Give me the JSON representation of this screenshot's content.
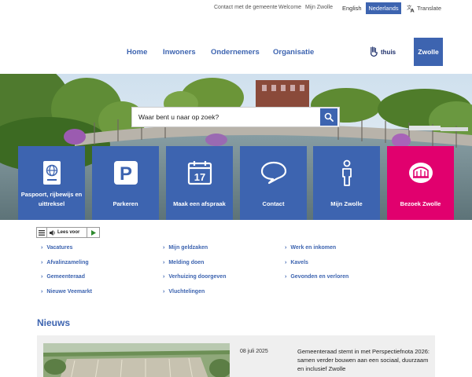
{
  "topbar": {
    "contact": "Contact met de gemeente",
    "welcome": "Welcome",
    "mijn_zwolle": "Mijn Zwolle",
    "lang_en": "English",
    "lang_nl": "Nederlands",
    "translate": "Translate"
  },
  "nav": {
    "items": [
      "Home",
      "Inwoners",
      "Ondernemers",
      "Organisatie"
    ],
    "thuis": "thuis",
    "logo": "Zwolle"
  },
  "search": {
    "placeholder": "Waar bent u naar op zoek?"
  },
  "tiles": [
    {
      "label": "Paspoort, rijbewijs en uittreksel",
      "icon": "passport-icon"
    },
    {
      "label": "Parkeren",
      "icon": "parking-icon"
    },
    {
      "label": "Maak een afspraak",
      "icon": "calendar-icon",
      "day": "17"
    },
    {
      "label": "Contact",
      "icon": "speech-bubble-icon"
    },
    {
      "label": "Mijn Zwolle",
      "icon": "person-icon"
    },
    {
      "label": "Bezoek Zwolle",
      "icon": "building-icon"
    }
  ],
  "readspeaker": {
    "label": "Lees voor"
  },
  "quicklinks": {
    "col1": [
      "Vacatures",
      "Afvalinzameling",
      "Gemeenteraad",
      "Nieuwe Veemarkt"
    ],
    "col2": [
      "Mijn geldzaken",
      "Melding doen",
      "Verhuizing doorgeven",
      "Vluchtelingen"
    ],
    "col3": [
      "Werk en inkomen",
      "Kavels",
      "Gevonden en verloren"
    ]
  },
  "news": {
    "title": "Nieuws",
    "items": [
      {
        "date": "08 juli 2025",
        "headline": "Gemeenteraad stemt in met Perspectiefnota 2026: samen verder bouwen aan een sociaal, duurzaam en inclusief Zwolle"
      }
    ]
  },
  "colors": {
    "primary": "#3d64b0",
    "accent": "#e1006e",
    "news_bg": "#efefef"
  }
}
